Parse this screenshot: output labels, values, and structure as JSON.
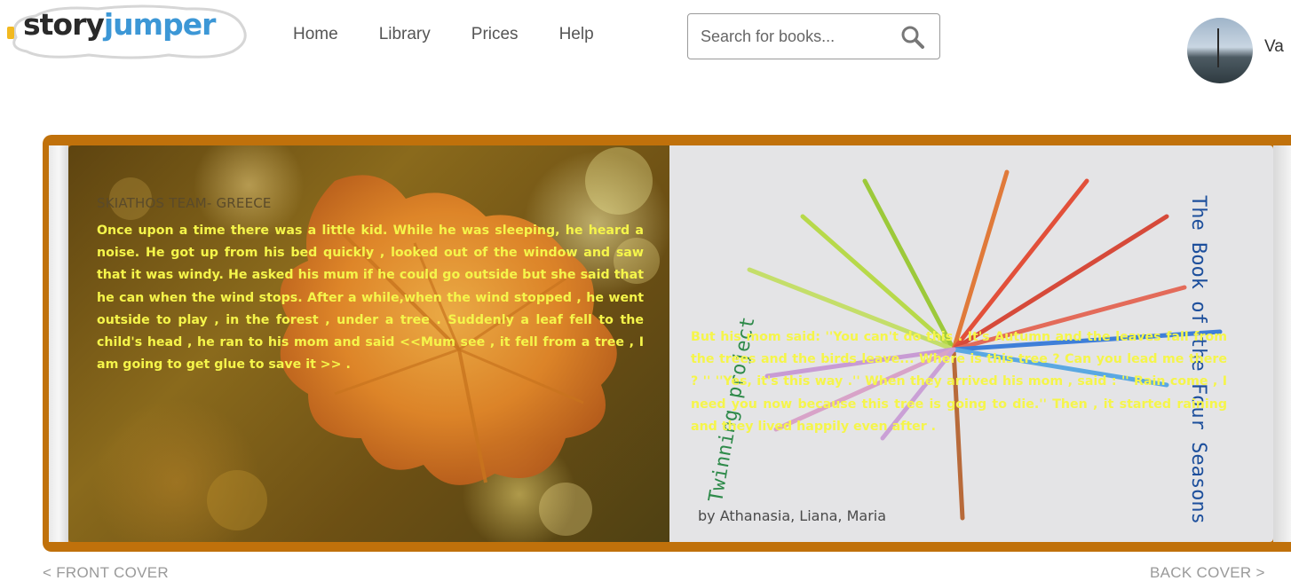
{
  "header": {
    "logo": {
      "part1": "story",
      "part2": "jumper"
    },
    "nav": [
      {
        "label": "Home"
      },
      {
        "label": "Library"
      },
      {
        "label": "Prices"
      },
      {
        "label": "Help"
      }
    ],
    "search": {
      "placeholder": "Search for books..."
    },
    "user": {
      "name": "Va"
    }
  },
  "book": {
    "left_page": {
      "title": "SKIATHOS TEAM- GREECE",
      "text": "Once upon a time there was a little kid. While he was sleeping, he heard a noise. He got up from his bed quickly , looked out of the window and saw that it was windy. He asked his mum if he could go outside but she said that he can when the wind  stops. After a while,when the wind stopped , he went outside to play , in the forest , under a tree . Suddenly a leaf fell to the child's head , he ran to his mom and said <<Mum see , it fell from a tree , I am going to get glue to save it >> ."
    },
    "right_page": {
      "text": "But his mom said: ''You can't do this . It's Autumn and the leaves fall from the trees and the birds leave... Where is this tree ? Can you lead me there ? '' ''Yes, it's this way .''  When they arrived his mom , said : '' Rain come , I need you now because this tree is going to die.'' Then , it started raining and they lived happily even after .",
      "byline": "by Athanasia, Liana, Maria",
      "drawing_title": "The Book of the Four Seasons",
      "drawing_label": "Twinning project"
    }
  },
  "navigation": {
    "front_cover": "< FRONT COVER",
    "back_cover": "BACK COVER >"
  },
  "colors": {
    "accent_blue": "#3c97d6",
    "book_frame": "#c0710b",
    "story_text": "#f5f54a"
  }
}
